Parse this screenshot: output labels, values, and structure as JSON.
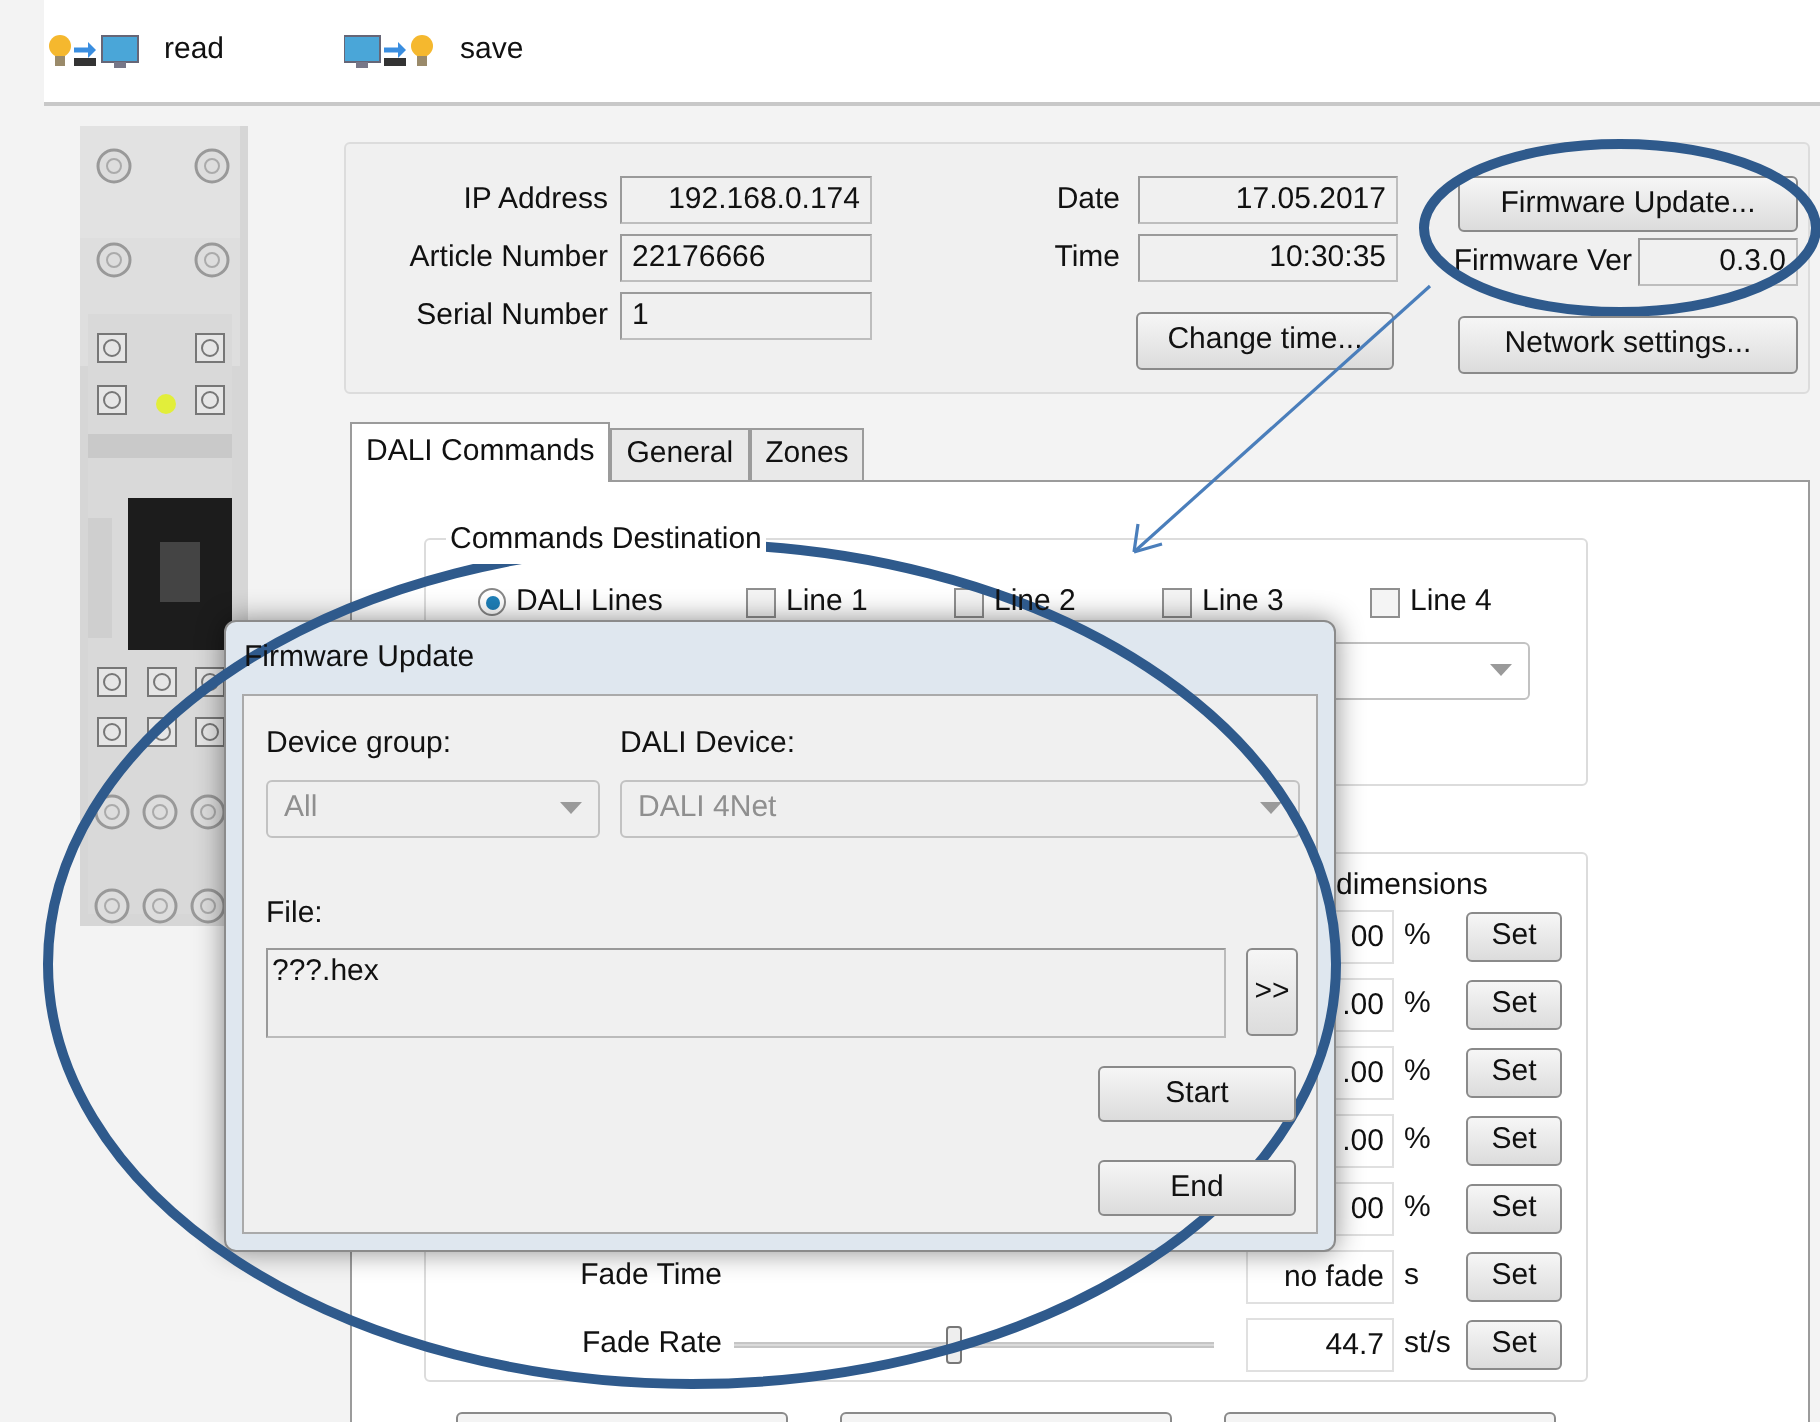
{
  "toolbar": [
    {
      "kind": "read",
      "label": "read"
    },
    {
      "kind": "save",
      "label": "save"
    }
  ],
  "device_info": {
    "fields": [
      {
        "label": "IP Address",
        "value": "192.168.0.174",
        "kind": "address"
      },
      {
        "label": "Article Number",
        "value": "22176666",
        "kind": "number"
      },
      {
        "label": "Serial Number",
        "value": "1",
        "kind": "number"
      }
    ],
    "date": {
      "label": "Date",
      "value": "17.05.2017"
    },
    "time": {
      "label": "Time",
      "value": "10:30:35"
    },
    "change_time_button": "Change time...",
    "firmware_update_button": "Firmware Update...",
    "firmware_version": {
      "label": "Firmware Ver",
      "value": "0.3.0"
    },
    "network_settings_button": "Network settings..."
  },
  "tabs": [
    {
      "label": "DALI Commands",
      "selected": true
    },
    {
      "label": "General",
      "selected": false
    },
    {
      "label": "Zones",
      "selected": false
    }
  ],
  "commands_destination": {
    "title": "Commands Destination",
    "radio": {
      "label": "DALI Lines",
      "selected": true
    },
    "lines": [
      {
        "label": "Line 1",
        "checked": false
      },
      {
        "label": "Line 2",
        "checked": false
      },
      {
        "label": "Line 3",
        "checked": false
      },
      {
        "label": "Line 4",
        "checked": false
      }
    ]
  },
  "dimensions_group": {
    "title": "dimensions",
    "rows": [
      {
        "kind": "hidden",
        "value": "00",
        "unit": "%",
        "button": "Set"
      },
      {
        "kind": "hidden",
        "value": ".00",
        "unit": "%",
        "button": "Set"
      },
      {
        "kind": "hidden",
        "value": ".00",
        "unit": "%",
        "button": "Set"
      },
      {
        "kind": "hidden",
        "value": ".00",
        "unit": "%",
        "button": "Set"
      },
      {
        "kind": "hidden",
        "value": "00",
        "unit": "%",
        "button": "Set"
      },
      {
        "kind": "plain",
        "label": "Fade Time",
        "value": "no fade",
        "unit": "s",
        "button": "Set"
      },
      {
        "kind": "slider",
        "label": "Fade Rate",
        "level": 0.46,
        "value": "44.7",
        "unit": "st/s",
        "button": "Set"
      }
    ]
  },
  "dialog": {
    "title": "Firmware Update",
    "device_group": {
      "label": "Device group:",
      "value": "All",
      "disabled": true
    },
    "dali_device": {
      "label": "DALI Device:",
      "value": "DALI 4Net",
      "disabled": true
    },
    "file": {
      "label": "File:",
      "value": "???.hex"
    },
    "browse_button": ">>",
    "buttons": [
      "Start",
      "End"
    ]
  }
}
